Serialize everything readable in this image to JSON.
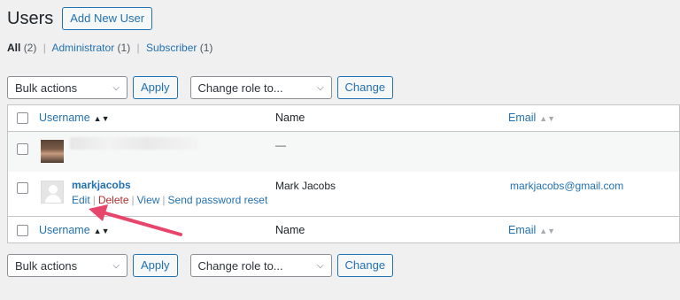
{
  "header": {
    "title": "Users",
    "add_new_label": "Add New User"
  },
  "filters": {
    "all_label": "All",
    "all_count": "(2)",
    "admin_label": "Administrator",
    "admin_count": "(1)",
    "subscriber_label": "Subscriber",
    "subscriber_count": "(1)",
    "separator": "|"
  },
  "tablenav": {
    "bulk_actions": "Bulk actions",
    "apply_label": "Apply",
    "change_role": "Change role to...",
    "change_label": "Change"
  },
  "columns": {
    "username": "Username",
    "name": "Name",
    "email": "Email"
  },
  "rows": [
    {
      "username": "",
      "name": "—",
      "email": ""
    },
    {
      "username": "markjacobs",
      "name": "Mark Jacobs",
      "email": "markjacobs@gmail.com",
      "actions": {
        "edit": "Edit",
        "delete": "Delete",
        "view": "View",
        "reset": "Send password reset"
      }
    }
  ],
  "colors": {
    "accent": "#2271b1",
    "annotation_arrow": "#e8456b",
    "delete": "#b32d2e"
  },
  "icons": {
    "sort_active": "sort-updown-icon",
    "sort_inactive": "sort-updown-icon",
    "dropdown": "chevron-down-icon"
  }
}
